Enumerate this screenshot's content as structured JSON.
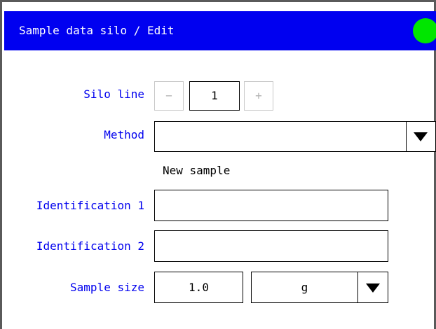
{
  "window": {
    "title": "Sample data silo / Edit",
    "status_color": "#00e600"
  },
  "form": {
    "silo_line": {
      "label": "Silo line",
      "decrement": "−",
      "value": "1",
      "increment": "+"
    },
    "method": {
      "label": "Method",
      "value": "",
      "dropdown_icon": "triangle-down-icon"
    },
    "new_sample_text": "New sample",
    "identification_1": {
      "label": "Identification 1",
      "value": ""
    },
    "identification_2": {
      "label": "Identification 2",
      "value": ""
    },
    "sample_size": {
      "label": "Sample size",
      "value": "1.0",
      "unit": "g",
      "dropdown_icon": "triangle-down-icon"
    }
  }
}
